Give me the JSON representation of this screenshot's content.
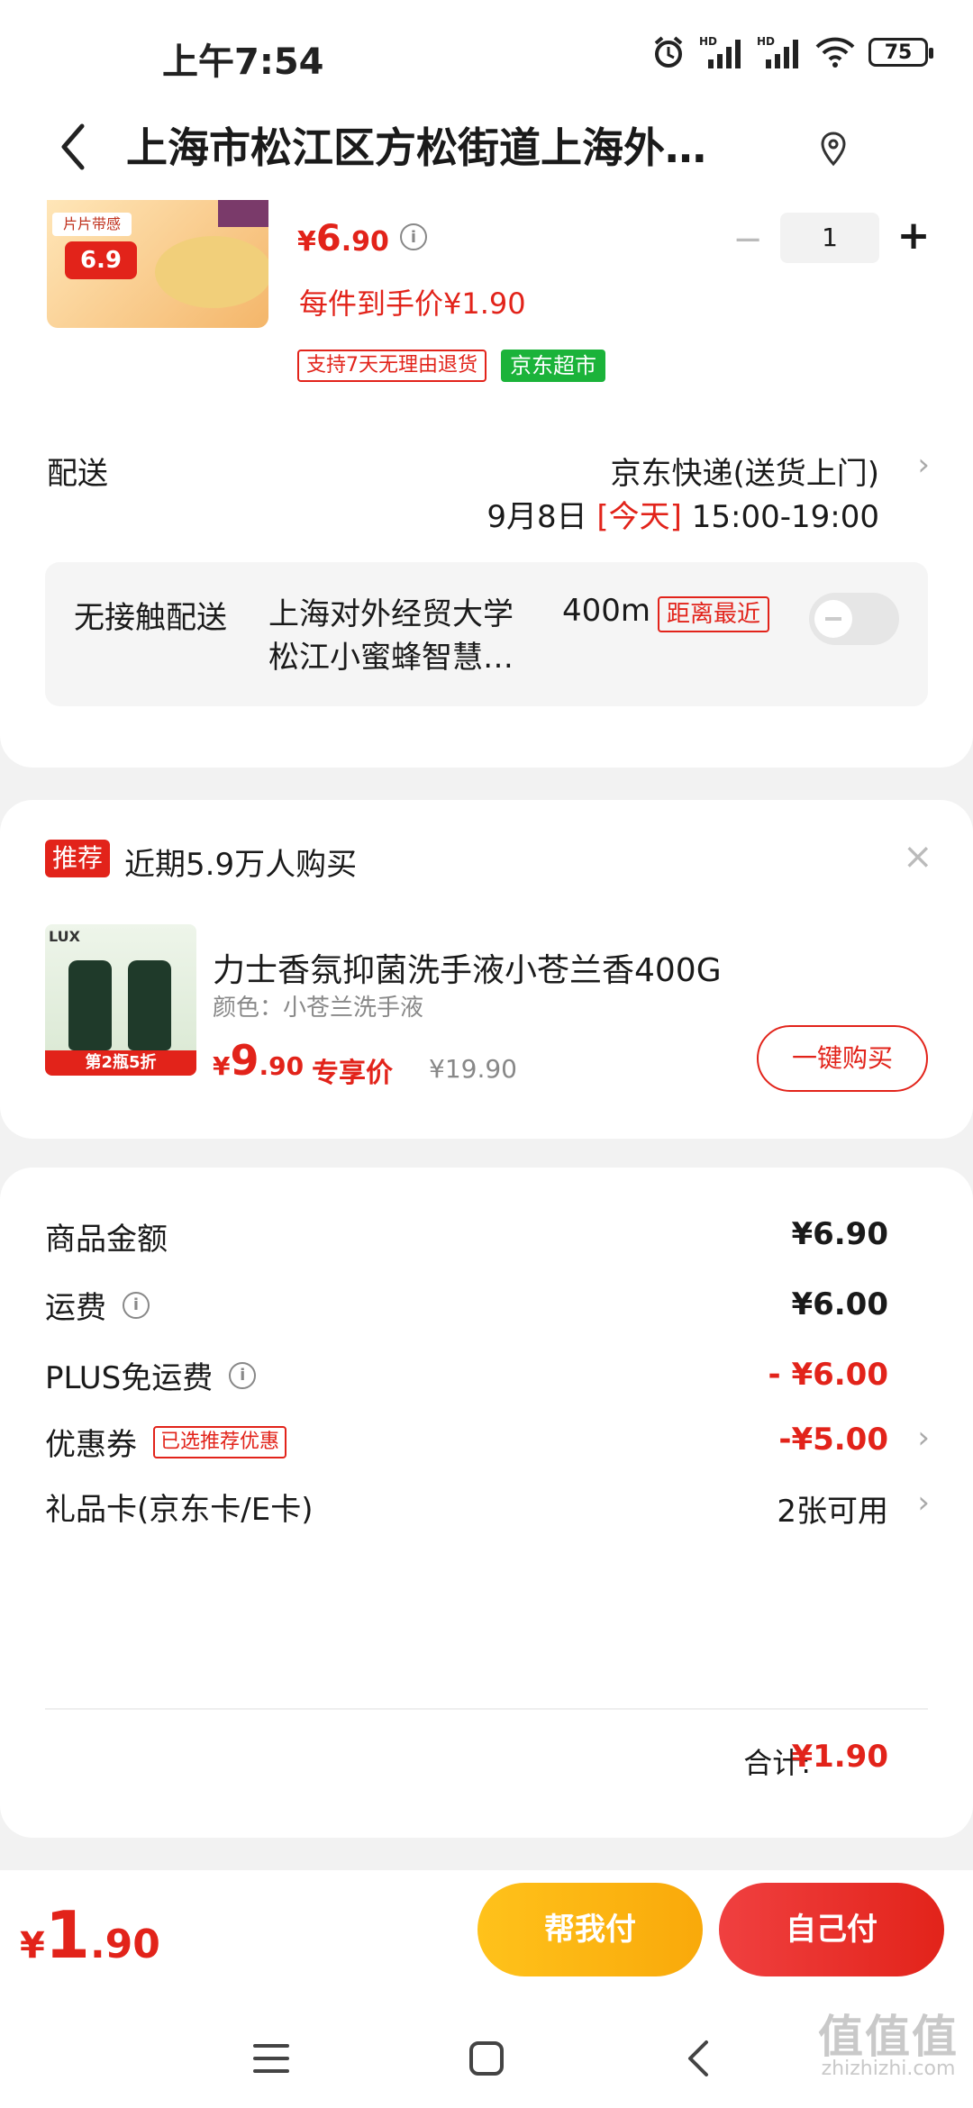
{
  "status_bar": {
    "time": "上午7:54",
    "battery": "75",
    "hd1": "HD",
    "hd2": "HD"
  },
  "header": {
    "title": "上海市松江区方松街道上海外…"
  },
  "product": {
    "thumb_tag": "片片带感",
    "thumb_price": "6.9",
    "price_symbol": "¥",
    "price_int": "6",
    "price_dec": ".90",
    "net_price": "每件到手价¥1.90",
    "tag_return": "支持7天无理由退货",
    "tag_market": "京东超市",
    "quantity": "1",
    "minus": "−",
    "plus": "+"
  },
  "delivery": {
    "label": "配送",
    "method": "京东快递(送货上门)",
    "date": "9月8日",
    "today": "[今天]",
    "time": "15:00-19:00",
    "chevron": "›"
  },
  "contactless": {
    "label": "无接触配送",
    "location": "上海对外经贸大学 松江小蜜蜂智慧…",
    "distance": "400m",
    "badge": "距离最近"
  },
  "recommend": {
    "badge": "推荐",
    "title": "近期5.9万人购买",
    "close": "×",
    "thumb_logo": "LUX",
    "thumb_strip": "第2瓶5折",
    "name": "力士香氛抑菌洗手液小苍兰香400G",
    "spec": "颜色：小苍兰洗手液",
    "price_symbol": "¥",
    "price_int": "9",
    "price_dec": ".90",
    "exclusive": "专享价",
    "original_price": "¥19.90",
    "buy_label": "一键购买"
  },
  "summary": {
    "rows": [
      {
        "label": "商品金额",
        "value": "¥6.90"
      },
      {
        "label": "运费",
        "value": "¥6.00"
      },
      {
        "label": "PLUS免运费",
        "value": "- ¥6.00"
      },
      {
        "label": "优惠券",
        "tag": "已选推荐优惠",
        "value": "-¥5.00"
      },
      {
        "label": "礼品卡(京东卡/E卡)",
        "value": "2张可用"
      }
    ],
    "total_label": "合计:",
    "total_value": "¥1.90"
  },
  "paybar": {
    "symbol": "¥",
    "int": "1",
    "dec": ".90",
    "help_pay": "帮我付",
    "self_pay": "自己付"
  },
  "watermark": {
    "big": "值值值",
    "small": "zhizhizhi.com"
  },
  "colors": {
    "accent": "#e2231a",
    "market_green": "#1bb33a",
    "help_pay": "#ffc21b"
  }
}
